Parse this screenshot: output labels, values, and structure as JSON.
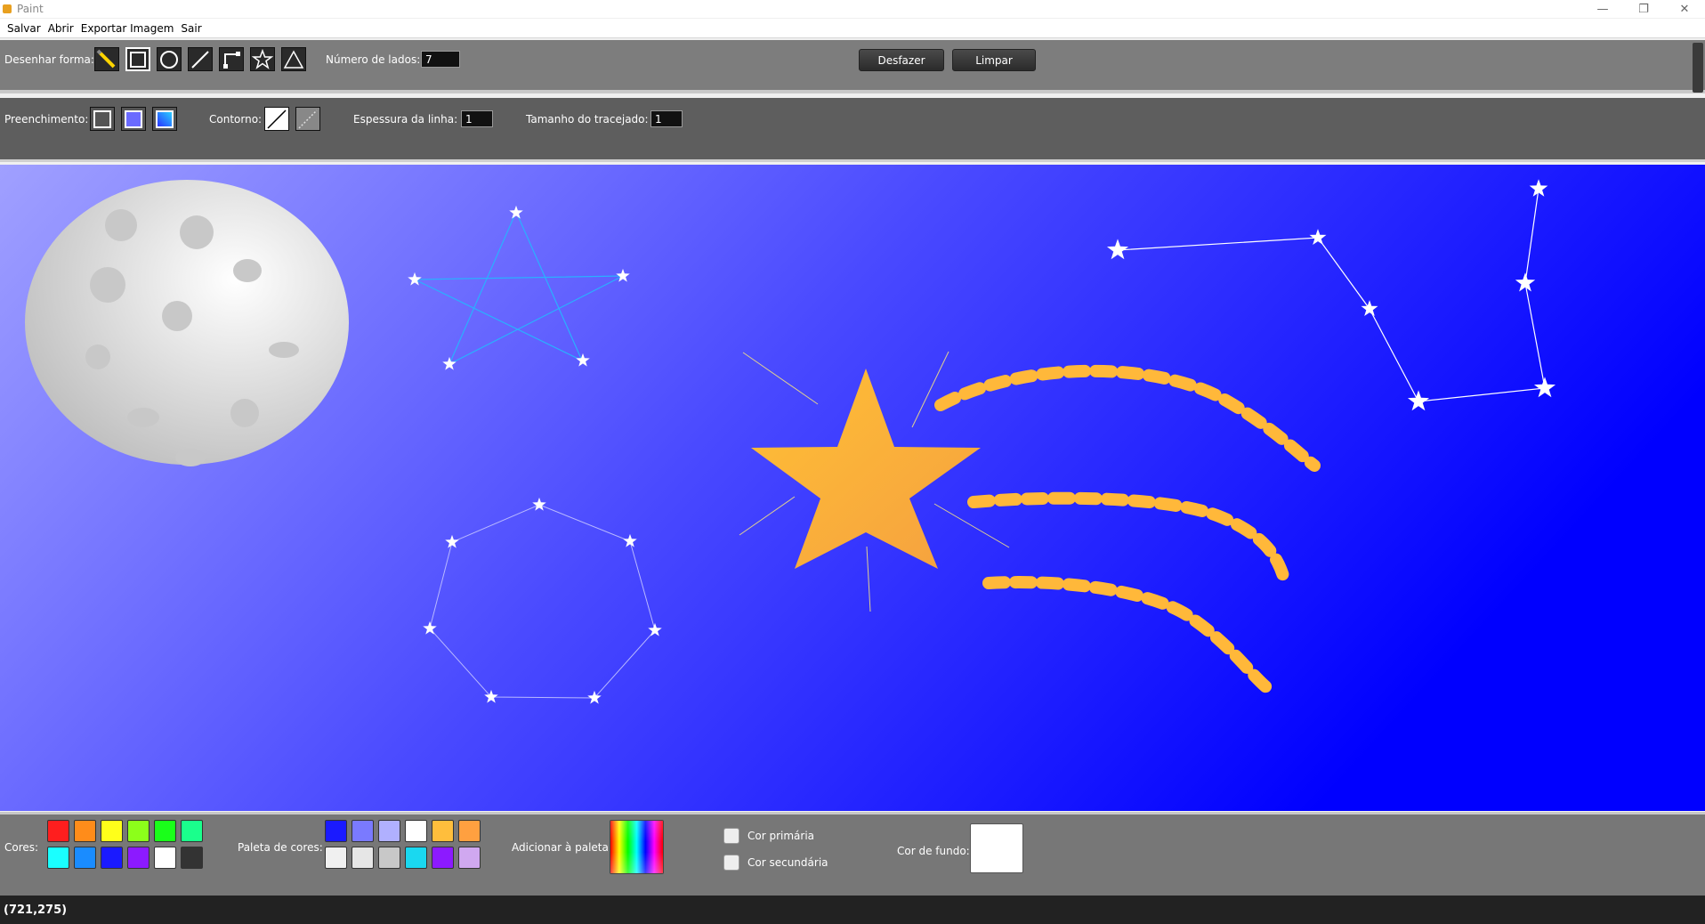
{
  "window": {
    "title": "Paint",
    "minimize": "—",
    "maximize": "❐",
    "close": "✕"
  },
  "menu": [
    "Salvar",
    "Abrir",
    "Exportar Imagem",
    "Sair"
  ],
  "toolbar1": {
    "draw_shape_label": "Desenhar forma:",
    "tools": [
      "pencil-icon",
      "rectangle-icon",
      "circle-icon",
      "line-icon",
      "polyline-icon",
      "star-icon",
      "triangle-icon"
    ],
    "sides_label": "Número de lados:",
    "sides_value": "7",
    "undo_label": "Desfazer",
    "clear_label": "Limpar"
  },
  "toolbar2": {
    "fill_label": "Preenchimento:",
    "fill_options": [
      "no-fill-icon",
      "solid-fill-icon",
      "gradient-fill-icon"
    ],
    "outline_label": "Contorno:",
    "outline_options": [
      "solid-outline-icon",
      "dashed-outline-icon"
    ],
    "line_width_label": "Espessura da linha:",
    "line_width_value": "1",
    "dash_size_label": "Tamanho do tracejado:",
    "dash_size_value": "1"
  },
  "bottom": {
    "colors_label": "Cores:",
    "colors": [
      "#ff1e1e",
      "#ff8c1a",
      "#ffff1a",
      "#8cff1a",
      "#1aff1a",
      "#1aff8c",
      "#1affff",
      "#1a8cff",
      "#1a1aff",
      "#8c1aff",
      "#ffffff",
      "#333333"
    ],
    "palette_label": "Paleta de cores:",
    "palette": [
      "#1a1aff",
      "#7a7aff",
      "#b0b0ff",
      "#ffffff",
      "#ffbe3c",
      "#ffa040",
      "#f0f0f0",
      "#e6e6e6",
      "#c8c8c8",
      "#1ad8f0",
      "#8c1aff",
      "#d0a8f0"
    ],
    "add_to_palette_label": "Adicionar à paleta:",
    "primary_label": "Cor primária",
    "secondary_label": "Cor secundária",
    "background_label": "Cor de fundo:",
    "background_color": "#ffffff"
  },
  "status": {
    "coordinates": "(721,275)"
  }
}
